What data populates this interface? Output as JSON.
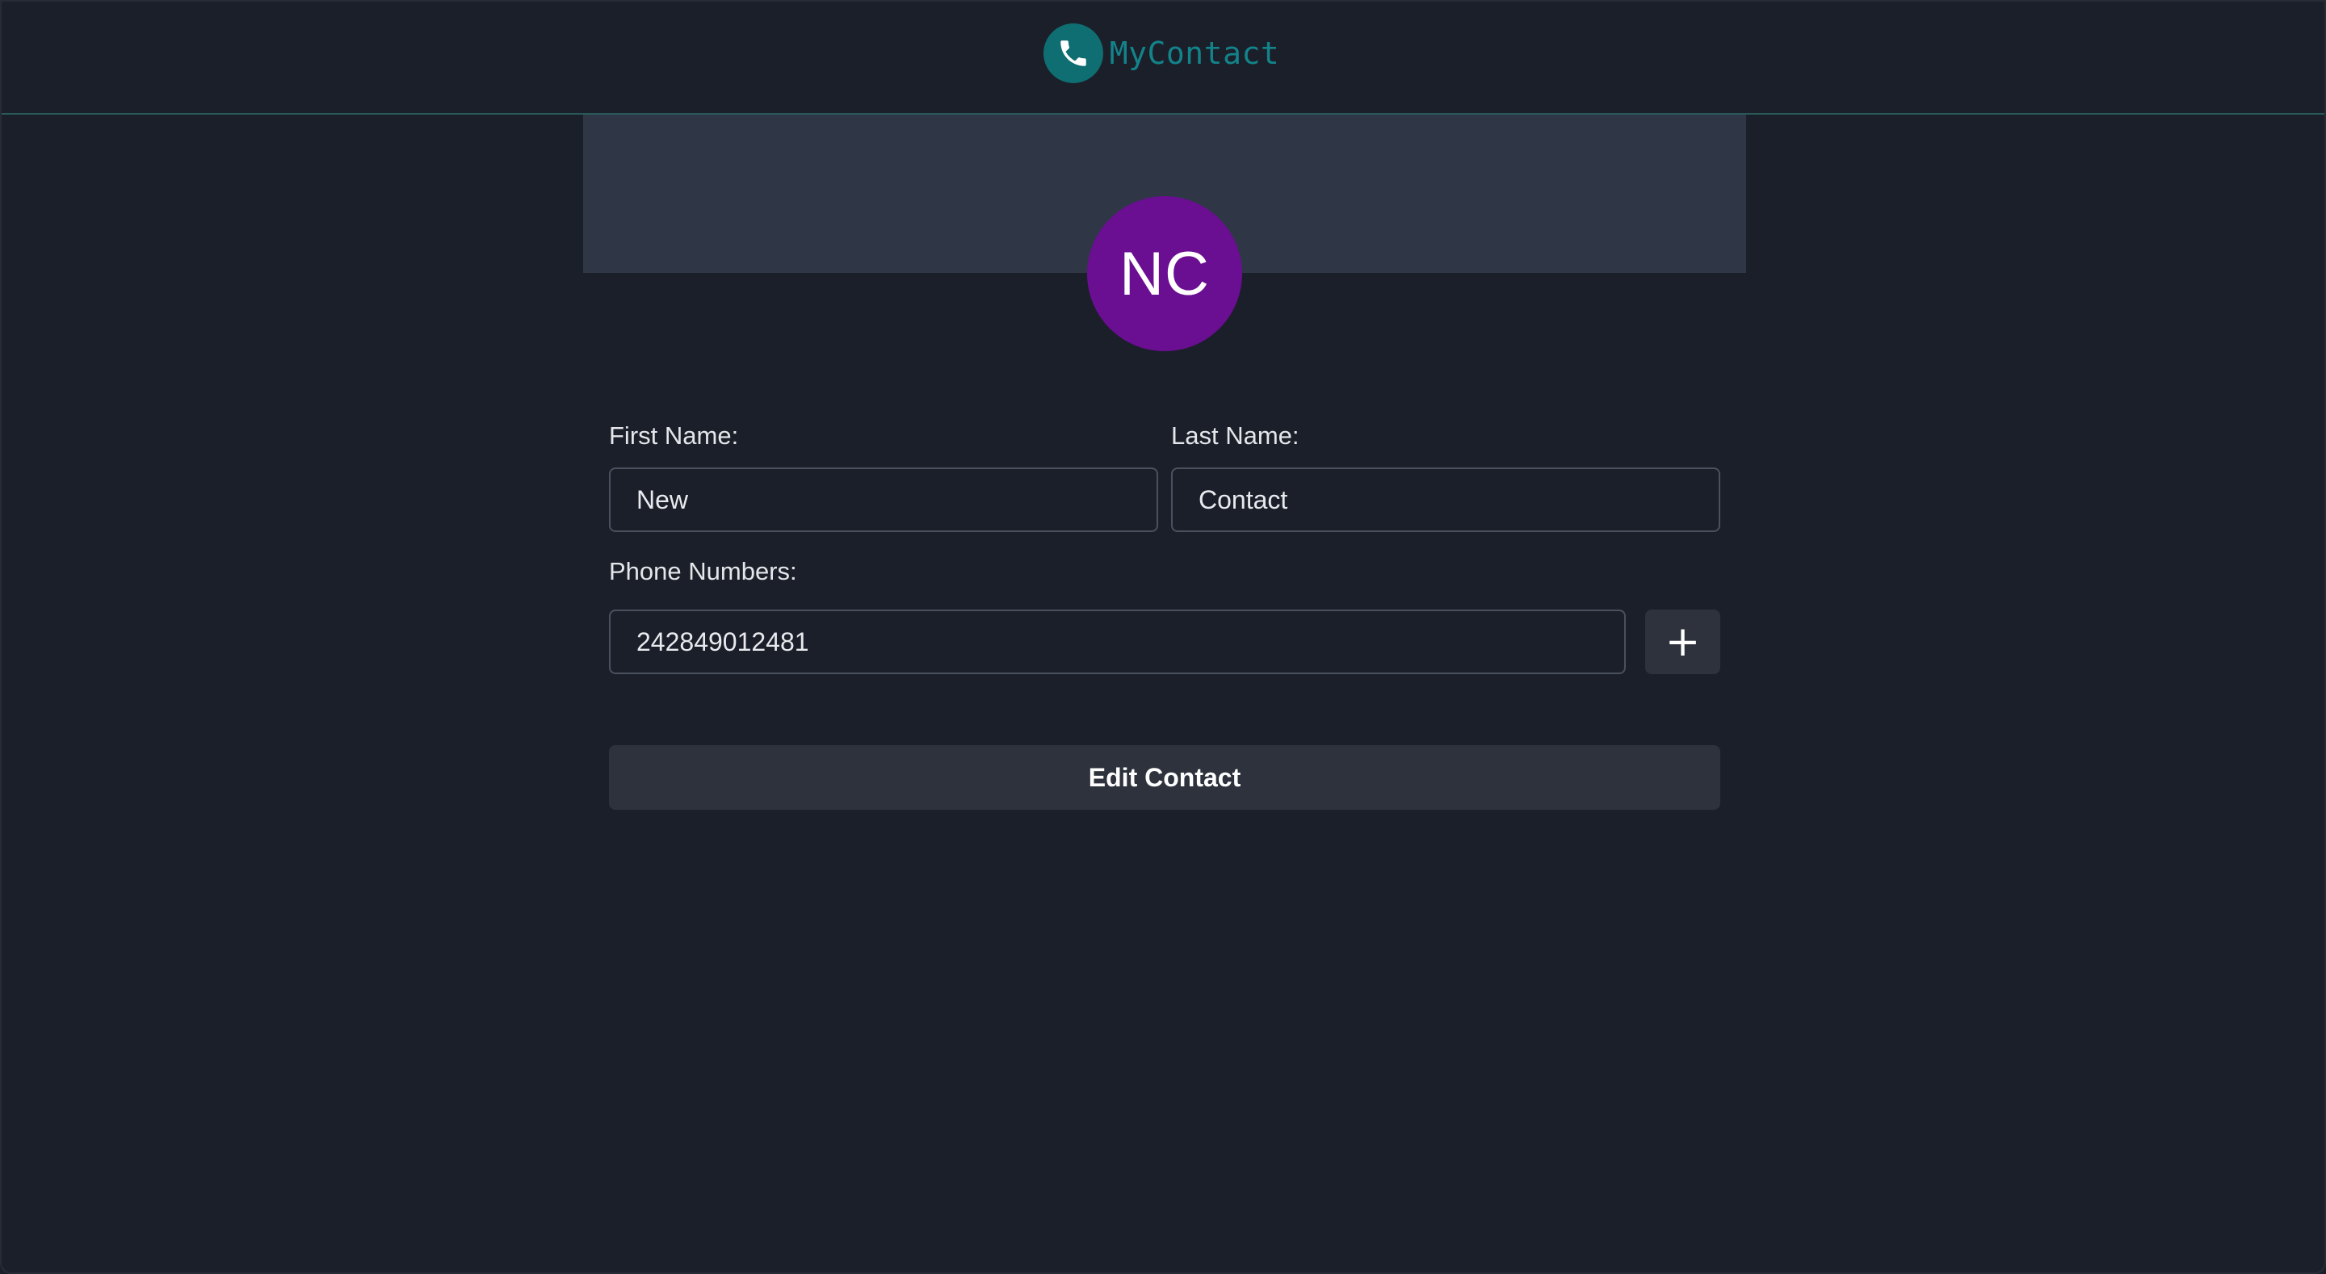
{
  "header": {
    "brand_name": "MyContact",
    "logo_icon": "phone-icon",
    "accent_color": "#0e6e72"
  },
  "contact": {
    "avatar_initials": "NC",
    "avatar_color": "#6a0e92"
  },
  "form": {
    "first_name_label": "First Name:",
    "first_name_value": "New",
    "last_name_label": "Last Name:",
    "last_name_value": "Contact",
    "phone_label": "Phone Numbers:",
    "phone_numbers": [
      "242849012481"
    ],
    "add_phone_icon": "plus-icon",
    "add_phone_symbol": "+",
    "submit_label": "Edit Contact"
  }
}
